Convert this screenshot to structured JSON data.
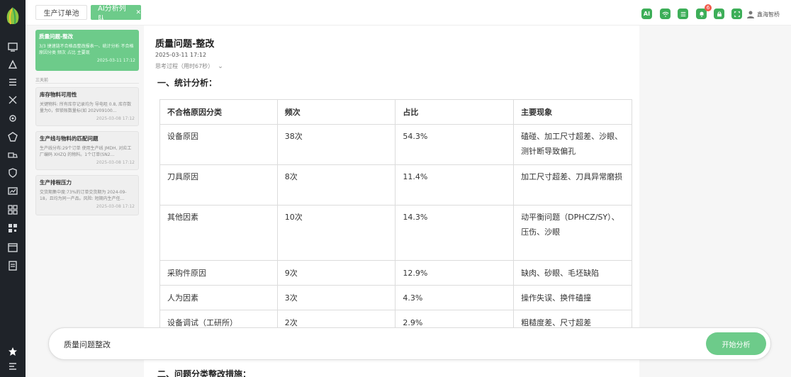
{
  "tabs": [
    {
      "label": "生产订单池",
      "active": false
    },
    {
      "label": "AI分析列队",
      "active": true
    }
  ],
  "header": {
    "icons": [
      "ai-icon",
      "wifi-icon",
      "list-icon",
      "bell-icon",
      "lock-icon",
      "fullscreen-icon"
    ],
    "ai_label": "AI",
    "notification_count": "6",
    "user_name": "鑫海智桥"
  },
  "conversations": [
    {
      "title": "质量问题-整改",
      "desc": "3/3 捷速链不合格品整改报表一、统计分析 不合格原因分类 频次 占比 主要现",
      "time": "2025-03-11 17:12",
      "active": true
    },
    {
      "title": "库存物料可用性",
      "desc": "关键物料: 所有库存记录均为 导电咀 0.8, 库存数量为0，但锁账数量标(如 202V09100...",
      "time": "2025-03-08 17:12",
      "active": false
    },
    {
      "title": "生产线与物料的匹配问题",
      "desc": "生产线分布:29个订单 使用生产线 JMDH, 对应工厂编码 XHZQ 的物料。1个订单(SN2...",
      "time": "2025-03-08 17:12",
      "active": false
    },
    {
      "title": "生产排程压力",
      "desc": "交货期集中度:73%的订单交货期为 2024-09-18，且均为同一产品。风险: 短期内生产任...",
      "time": "2025-03-08 17:12",
      "active": false
    }
  ],
  "group_label": "三天前",
  "message": {
    "title": "质量问题-整改",
    "time": "2025-03-11 17:12",
    "thinking": "思考过程（用时67秒）",
    "section1": "一、统计分析：",
    "section2": "二、问题分类整改措施：",
    "table": {
      "headers": [
        "不合格原因分类",
        "频次",
        "占比",
        "主要现象"
      ],
      "rows": [
        [
          "设备原因",
          "38次",
          "54.3%",
          "磕碰、加工尺寸超差、沙眼、测针断导致偏孔"
        ],
        [
          "刀具原因",
          "8次",
          "11.4%",
          "加工尺寸超差、刀具异常磨损"
        ],
        [
          "其他因素",
          "10次",
          "14.3%",
          "动平衡问题（DPHCZ/SY）、压伤、沙眼"
        ],
        [
          "采购件原因",
          "9次",
          "12.9%",
          "缺肉、砂眼、毛坯缺陷"
        ],
        [
          "人为因素",
          "3次",
          "4.3%",
          "操作失误、换件磕撞"
        ],
        [
          "设备调试（工研所）",
          "2次",
          "2.9%",
          "粗糙度差、尺寸超差"
        ]
      ]
    }
  },
  "input": {
    "value": "质量问题整改",
    "send_label": "开始分析"
  },
  "colors": {
    "accent": "#6dcb8a",
    "accent_dark": "#3dae58",
    "rail": "#1f2329",
    "badge": "#f05a4a"
  }
}
